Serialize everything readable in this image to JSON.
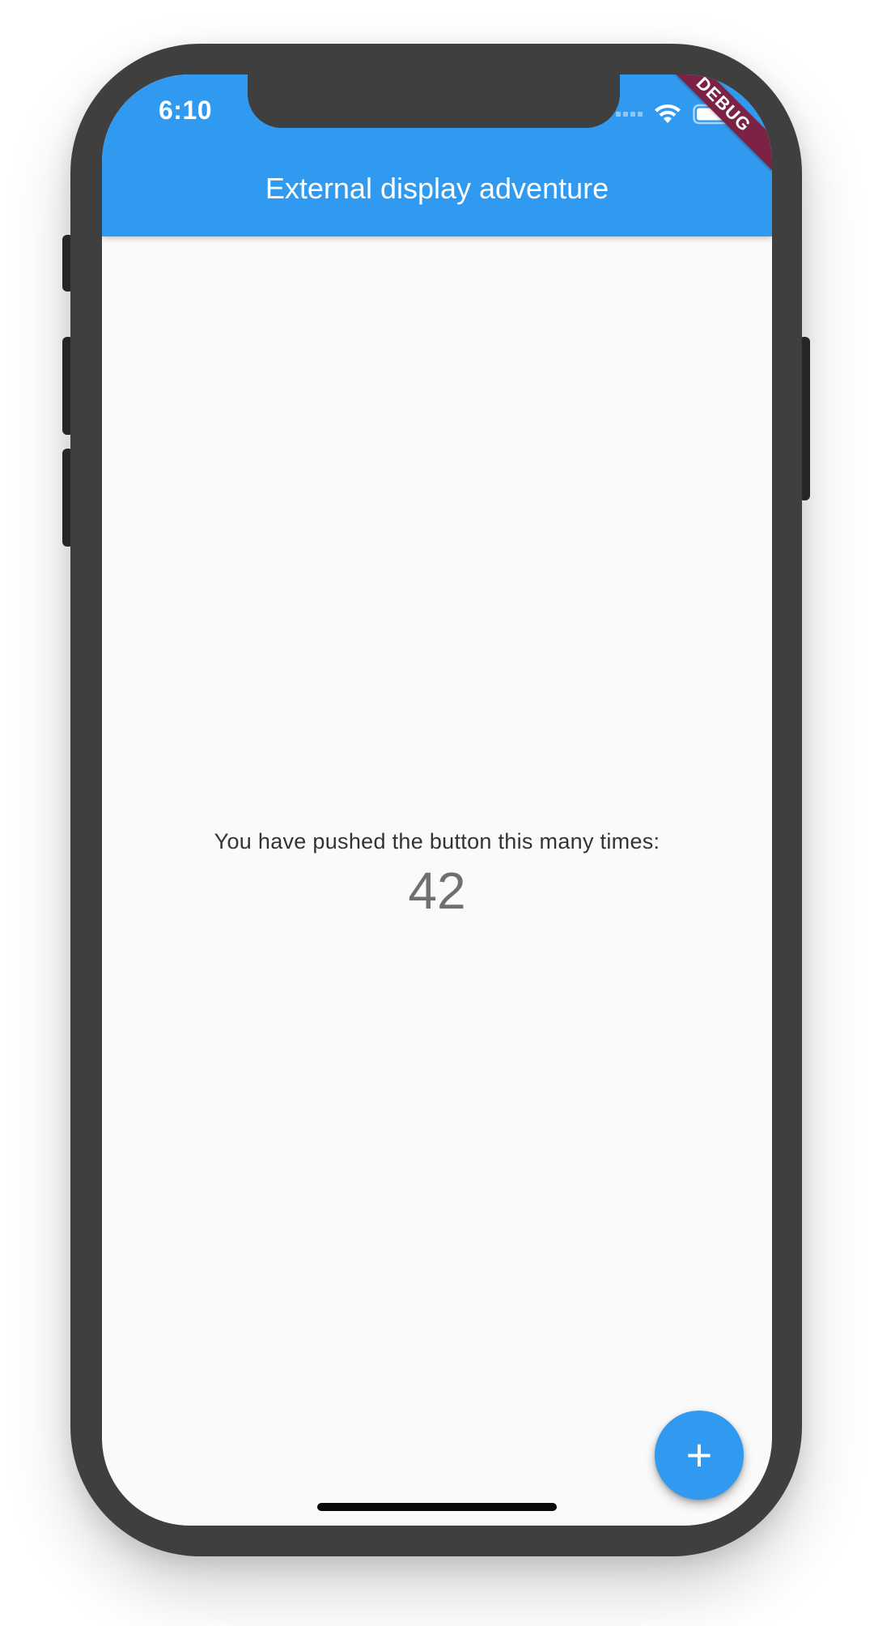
{
  "status_bar": {
    "time": "6:10",
    "icons": [
      "cellular-signal-icon",
      "wifi-icon",
      "battery-icon"
    ]
  },
  "app_bar": {
    "title": "External display adventure",
    "color": "#2f9af0"
  },
  "debug_banner": {
    "label": "DEBUG",
    "color": "#7b2245"
  },
  "counter": {
    "label": "You have pushed the button this many times:",
    "value": "42"
  },
  "fab": {
    "icon": "plus-icon",
    "symbol": "+",
    "color": "#2f9af0"
  },
  "device": {
    "frame_color": "#3f3f3f",
    "screen_background": "#fafafa"
  }
}
